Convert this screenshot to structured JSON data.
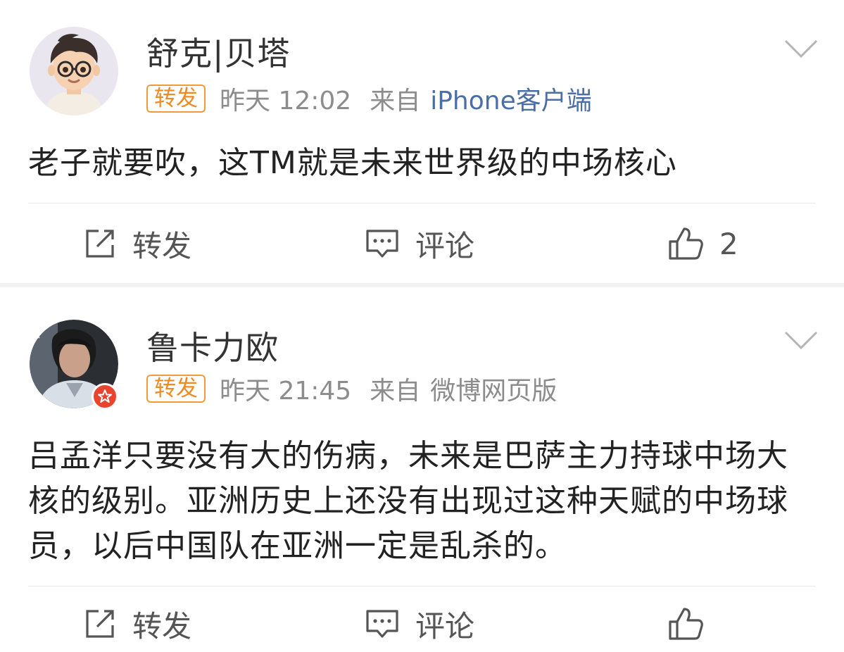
{
  "posts": [
    {
      "username": "舒克|贝塔",
      "badge": "转发",
      "time": "昨天 12:02",
      "source_label": "来自",
      "source": "iPhone客户端",
      "content": "老子就要吹，这TM就是未来世界级的中场核心",
      "actions": {
        "repost": "转发",
        "comment": "评论",
        "like_count": "2"
      },
      "avatar_icon": "cartoon-boy-glasses-avatar"
    },
    {
      "username": "鲁卡力欧",
      "badge": "转发",
      "time": "昨天 21:45",
      "source_label": "来自",
      "source": "微博网页版",
      "content": "吕孟洋只要没有大的伤病，未来是巴萨主力持球中场大核的级别。亚洲历史上还没有出现过这种天赋的中场球员，以后中国队在亚洲一定是乱杀的。",
      "actions": {
        "repost": "转发",
        "comment": "评论",
        "like_count": ""
      },
      "avatar_icon": "photo-avatar-with-badge"
    }
  ],
  "colors": {
    "badge": "#f08a22",
    "source_link": "#4a6ea8",
    "meta_gray": "#8c8c8c"
  }
}
